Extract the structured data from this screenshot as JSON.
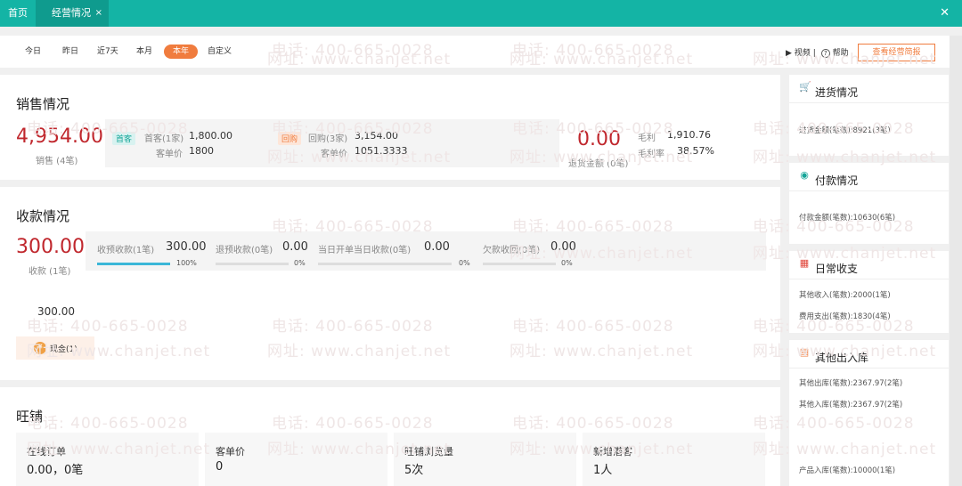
{
  "tabs": {
    "home": "首页",
    "active": "经营情况",
    "active_close": "×",
    "window_close": "✕"
  },
  "filters": {
    "options": [
      "今日",
      "昨日",
      "近7天",
      "本月",
      "本年",
      "自定义"
    ],
    "selected": "本年"
  },
  "toolbar": {
    "video_icon": "▶",
    "video": "视频",
    "sep": "|",
    "help_icon": "?",
    "help": "帮助",
    "report_button": "查看经营简报"
  },
  "sales": {
    "title": "销售情况",
    "total": "4,954.00",
    "total_label": "销售 (4笔)",
    "first_tag": "首客",
    "first_label": "首客(1家)",
    "first_value": "1,800.00",
    "first_unit_label": "客单价",
    "first_unit_value": "1800",
    "repeat_tag": "回购",
    "repeat_label": "回购(3家)",
    "repeat_value": "3,154.00",
    "repeat_unit_label": "客单价",
    "repeat_unit_value": "1051.3333",
    "refund": "0.00",
    "refund_label": "退货金额 (0笔)",
    "gross_label": "毛利",
    "gross_value": "1,910.76",
    "margin_label": "毛利率",
    "margin_value": "38.57%"
  },
  "collection": {
    "title": "收款情况",
    "total": "300.00",
    "total_label": "收款 (1笔)",
    "items": [
      {
        "label": "收预收款(1笔)",
        "value": "300.00",
        "pct": "100%",
        "ratio": 1.0
      },
      {
        "label": "退预收款(0笔)",
        "value": "0.00",
        "pct": "0%",
        "ratio": 0
      },
      {
        "label": "当日开单当日收款(0笔)",
        "value": "0.00",
        "pct": "0%",
        "ratio": 0
      },
      {
        "label": "欠款收回(0笔)",
        "value": "0.00",
        "pct": "0%",
        "ratio": 0
      }
    ],
    "cash_amount": "300.00",
    "cash_icon": "¥",
    "cash_label": "现金(1)"
  },
  "shop": {
    "title": "旺铺",
    "stats": [
      {
        "label": "在线订单",
        "value": "0.00，0笔"
      },
      {
        "label": "客单价",
        "value": "0"
      },
      {
        "label": "旺铺浏览量",
        "value": "5次"
      },
      {
        "label": "新增潜客",
        "value": "1人"
      }
    ]
  },
  "right": {
    "purchase": {
      "title": "进货情况",
      "icon": "purchase-icon",
      "line": "进货金额(笔数):8921(3笔)"
    },
    "payment": {
      "title": "付款情况",
      "icon": "payment-icon",
      "line": "付款金额(笔数):10630(6笔)"
    },
    "daily": {
      "title": "日常收支",
      "icon": "calendar-icon",
      "line1": "其他收入(笔数):2000(1笔)",
      "line2": "费用支出(笔数):1830(4笔)"
    },
    "stock": {
      "title": "其他出入库",
      "icon": "stock-icon",
      "line1": "其他出库(笔数):2367.97(2笔)",
      "line2": "其他入库(笔数):2367.97(2笔)",
      "line3": "产品入库(笔数):10000(1笔)"
    }
  },
  "watermark": {
    "phone": "电话: 400-665-0028",
    "site": "网址: www.chanjet.net"
  },
  "colors": {
    "teal": "#14b4a5",
    "orange": "#f07c3e",
    "red": "#c0272d",
    "progress": "#3bb7d8"
  }
}
